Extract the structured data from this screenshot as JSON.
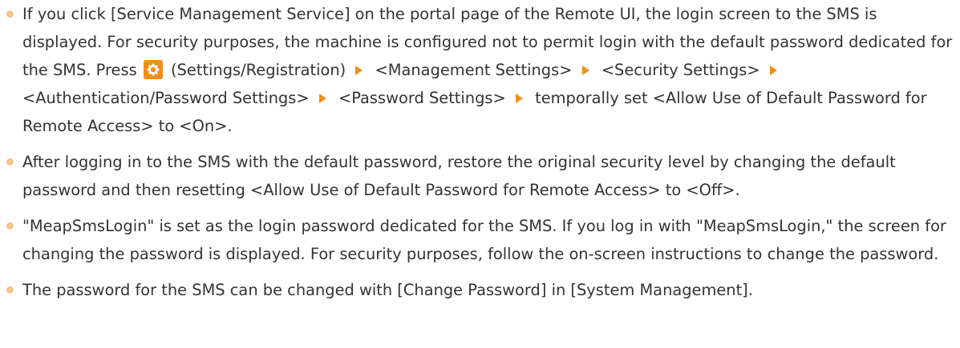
{
  "accent_color": "#f28e1c",
  "bullet_color": "#f5c38b",
  "icons": {
    "settings": "gear-icon",
    "step_arrow": "triangle-right-icon"
  },
  "notes": [
    {
      "intro": "If you click [Service Management Service] on the portal page of the Remote UI, the login screen to the SMS is displayed. For security purposes, the machine is configured not to permit login with the default password dedicated for the SMS. Press",
      "settings_label": "(Settings/Registration)",
      "steps": [
        "<Management Settings>",
        "<Security Settings>",
        "<Authentication/Password Settings>",
        "<Password Settings>",
        "temporally set <Allow Use of Default Password for Remote Access> to <On>."
      ]
    },
    {
      "text": "After logging in to the SMS with the default password, restore the original security level by changing the default password and then resetting <Allow Use of Default Password for Remote Access> to <Off>."
    },
    {
      "text": "\"MeapSmsLogin\" is set as the login password dedicated for the SMS. If you log in with \"MeapSmsLogin,\" the screen for changing the password is displayed. For security purposes, follow the on-screen instructions to change the password."
    },
    {
      "text": "The password for the SMS can be changed with [Change Password] in [System Management]."
    }
  ]
}
